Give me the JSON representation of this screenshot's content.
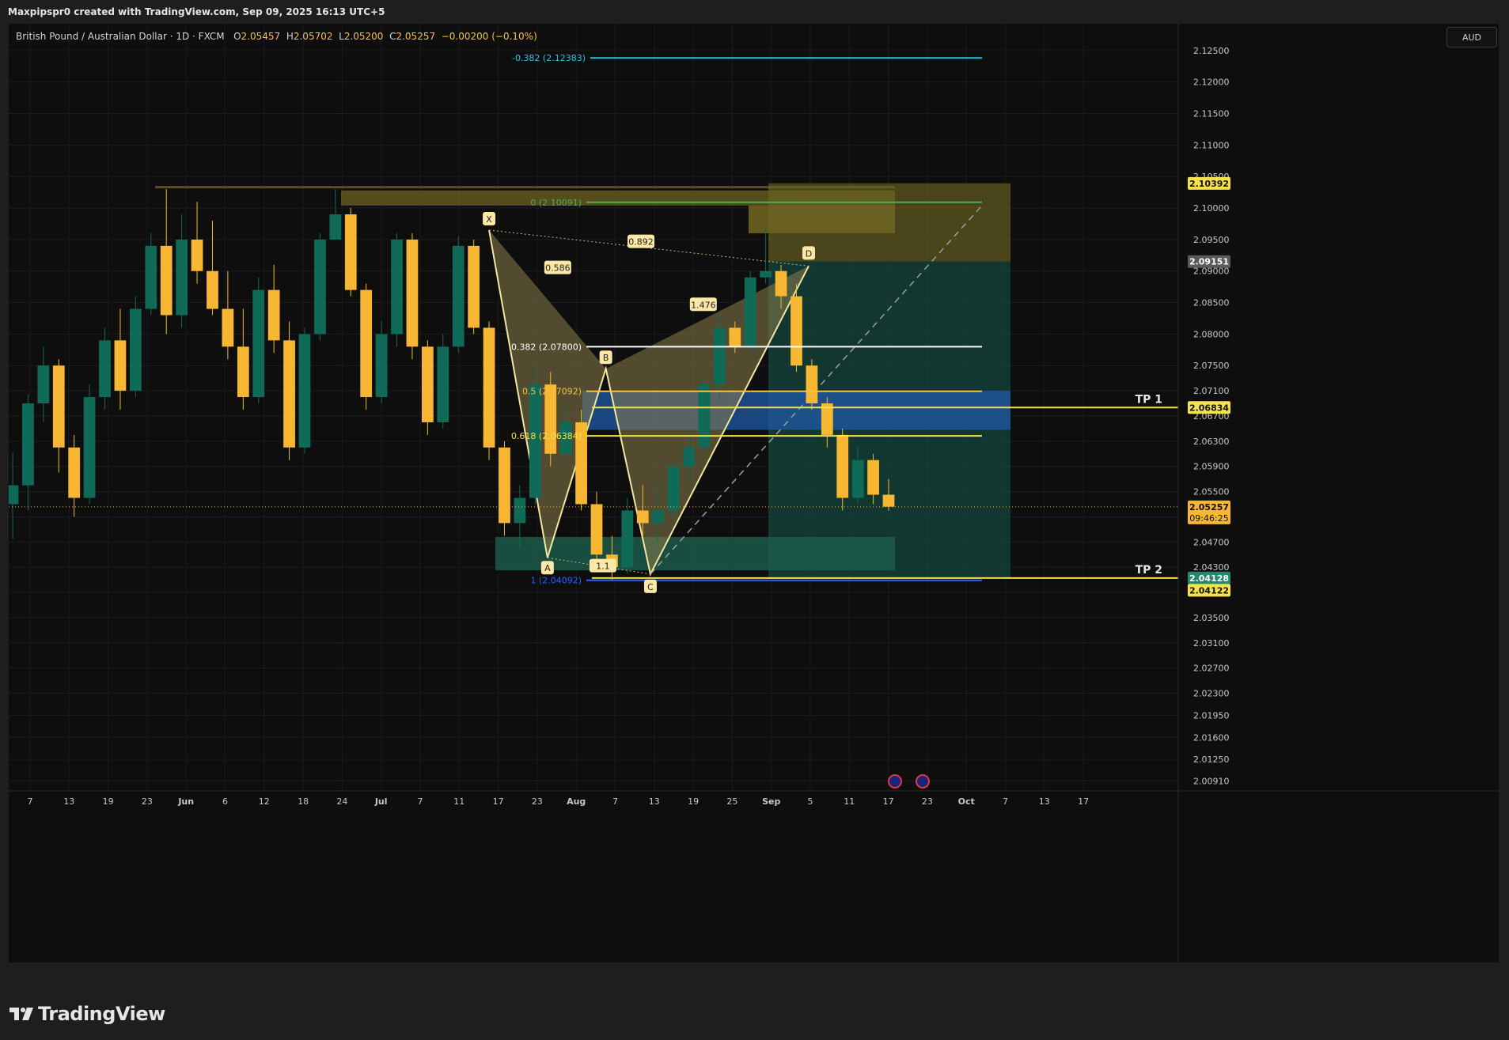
{
  "header": {
    "credit": "Maxpipspr0 created with TradingView.com, Sep 09, 2025 16:13 UTC+5"
  },
  "legend": {
    "symbol": "British Pound / Australian Dollar · 1D · FXCM",
    "open_label": "O",
    "open": "2.05457",
    "high_label": "H",
    "high": "2.05702",
    "low_label": "L",
    "low": "2.05200",
    "close_label": "C",
    "close": "2.05257",
    "change": "−0.00200 (−0.10%)"
  },
  "currency_button": "AUD",
  "brand": {
    "name": "TradingView"
  },
  "colors": {
    "background": "#0e0e0e",
    "bull": "#0f6b57",
    "bear": "#f7b733",
    "fib_cyan": "#26c6da",
    "fib_green": "#4caf50",
    "fib_white": "#ffffff",
    "fib_yellow": "#f6e24a",
    "fib_blue": "#2962ff",
    "pattern_fill": "#8b7d4d",
    "target_fill": "#145a4c"
  },
  "chart_data": {
    "type": "candlestick",
    "title": "British Pound / Australian Dollar · 1D · FXCM",
    "ylim": [
      2.0075,
      2.1285
    ],
    "y_ticks": [
      "2.12500",
      "2.12000",
      "2.11500",
      "2.11000",
      "2.10500",
      "2.10000",
      "2.09500",
      "2.09000",
      "2.08500",
      "2.08000",
      "2.07500",
      "2.07100",
      "2.06700",
      "2.06300",
      "2.05900",
      "2.05500",
      "2.05100",
      "2.04700",
      "2.04300",
      "2.03900",
      "2.03500",
      "2.03100",
      "2.02700",
      "2.02300",
      "2.01950",
      "2.01600",
      "2.01250",
      "2.00910"
    ],
    "x_ticks": [
      "7",
      "13",
      "19",
      "23",
      "Jun",
      "6",
      "12",
      "18",
      "24",
      "Jul",
      "7",
      "11",
      "17",
      "23",
      "Aug",
      "7",
      "13",
      "19",
      "25",
      "Sep",
      "5",
      "11",
      "17",
      "23",
      "Oct",
      "7",
      "13",
      "17"
    ],
    "ohlc_sampled": [
      [
        2.053,
        2.0612,
        2.0475,
        2.056
      ],
      [
        2.056,
        2.0705,
        2.052,
        2.069
      ],
      [
        2.069,
        2.078,
        2.066,
        2.075
      ],
      [
        2.075,
        2.076,
        2.058,
        2.062
      ],
      [
        2.062,
        2.064,
        2.051,
        2.054
      ],
      [
        2.054,
        2.072,
        2.053,
        2.07
      ],
      [
        2.07,
        2.081,
        2.068,
        2.079
      ],
      [
        2.079,
        2.084,
        2.068,
        2.071
      ],
      [
        2.071,
        2.086,
        2.07,
        2.084
      ],
      [
        2.084,
        2.096,
        2.083,
        2.094
      ],
      [
        2.094,
        2.103,
        2.08,
        2.083
      ],
      [
        2.083,
        2.099,
        2.081,
        2.095
      ],
      [
        2.095,
        2.101,
        2.088,
        2.09
      ],
      [
        2.09,
        2.098,
        2.083,
        2.084
      ],
      [
        2.084,
        2.09,
        2.076,
        2.078
      ],
      [
        2.078,
        2.084,
        2.068,
        2.07
      ],
      [
        2.07,
        2.089,
        2.069,
        2.087
      ],
      [
        2.087,
        2.091,
        2.077,
        2.079
      ],
      [
        2.079,
        2.082,
        2.06,
        2.062
      ],
      [
        2.062,
        2.081,
        2.061,
        2.08
      ],
      [
        2.08,
        2.096,
        2.079,
        2.095
      ],
      [
        2.095,
        2.103,
        2.095,
        2.099
      ],
      [
        2.099,
        2.1,
        2.086,
        2.087
      ],
      [
        2.087,
        2.088,
        2.068,
        2.07
      ],
      [
        2.07,
        2.082,
        2.069,
        2.08
      ],
      [
        2.08,
        2.096,
        2.078,
        2.095
      ],
      [
        2.095,
        2.096,
        2.076,
        2.078
      ],
      [
        2.078,
        2.079,
        2.064,
        2.066
      ],
      [
        2.066,
        2.08,
        2.065,
        2.078
      ],
      [
        2.078,
        2.0955,
        2.077,
        2.094
      ],
      [
        2.094,
        2.095,
        2.08,
        2.081
      ],
      [
        2.081,
        2.082,
        2.06,
        2.062
      ],
      [
        2.062,
        2.063,
        2.048,
        2.05
      ],
      [
        2.05,
        2.056,
        2.046,
        2.054
      ],
      [
        2.054,
        2.075,
        2.053,
        2.072
      ],
      [
        2.072,
        2.074,
        2.059,
        2.061
      ],
      [
        2.061,
        2.069,
        2.06,
        2.066
      ],
      [
        2.066,
        2.068,
        2.052,
        2.053
      ],
      [
        2.053,
        2.055,
        2.043,
        2.045
      ],
      [
        2.045,
        2.048,
        2.041,
        2.043
      ],
      [
        2.043,
        2.054,
        2.042,
        2.052
      ],
      [
        2.052,
        2.056,
        2.048,
        2.05
      ],
      [
        2.05,
        2.056,
        2.047,
        2.052
      ],
      [
        2.052,
        2.06,
        2.051,
        2.059
      ],
      [
        2.059,
        2.064,
        2.057,
        2.062
      ],
      [
        2.062,
        2.073,
        2.061,
        2.072
      ],
      [
        2.072,
        2.083,
        2.07,
        2.081
      ],
      [
        2.081,
        2.082,
        2.077,
        2.078
      ],
      [
        2.078,
        2.09,
        2.077,
        2.089
      ],
      [
        2.089,
        2.097,
        2.088,
        2.09
      ],
      [
        2.09,
        2.091,
        2.084,
        2.086
      ],
      [
        2.086,
        2.088,
        2.074,
        2.075
      ],
      [
        2.075,
        2.076,
        2.068,
        2.069
      ],
      [
        2.069,
        2.07,
        2.062,
        2.064
      ],
      [
        2.064,
        2.065,
        2.052,
        2.054
      ],
      [
        2.054,
        2.062,
        2.053,
        2.06
      ],
      [
        2.06,
        2.061,
        2.053,
        2.0545
      ],
      [
        2.0545,
        2.057,
        2.052,
        2.0526
      ]
    ],
    "last_price": "2.05257",
    "countdown": "09:46:25",
    "price_labels": [
      {
        "text": "2.10392",
        "kind": "yellow",
        "value": 2.10392
      },
      {
        "text": "2.09151",
        "kind": "gray",
        "value": 2.09151
      },
      {
        "text": "2.06834",
        "kind": "yellow",
        "value": 2.06834
      },
      {
        "text": "2.04128",
        "kind": "green",
        "value": 2.04128
      },
      {
        "text": "2.04122",
        "kind": "yellow",
        "value": 2.04122
      }
    ],
    "fib_levels": [
      {
        "label": "-0.382 (2.12383)",
        "value": 2.12383,
        "color": "#26c6da"
      },
      {
        "label": "0 (2.10091)",
        "value": 2.10091,
        "color": "#4caf50"
      },
      {
        "label": "0.382 (2.07800)",
        "value": 2.078,
        "color": "#ffffff"
      },
      {
        "label": "0.5 (2.07092)",
        "value": 2.07092,
        "color": "#f6c342"
      },
      {
        "label": "0.618 (2.06384)",
        "value": 2.06384,
        "color": "#f6e24a"
      },
      {
        "label": "1 (2.04092)",
        "value": 2.04092,
        "color": "#2962ff"
      }
    ],
    "take_profits": [
      {
        "label": "TP 1",
        "value": 2.06834
      },
      {
        "label": "TP 2",
        "value": 2.04128
      }
    ],
    "pattern": {
      "points": [
        {
          "label": "X",
          "value": 2.0965
        },
        {
          "label": "A",
          "value": 2.0445
        },
        {
          "label": "B",
          "value": 2.0745
        },
        {
          "label": "C",
          "value": 2.0419
        },
        {
          "label": "D",
          "value": 2.0908
        }
      ],
      "ratios": [
        "0.586",
        "0.892",
        "1.476",
        "1.1"
      ]
    }
  }
}
